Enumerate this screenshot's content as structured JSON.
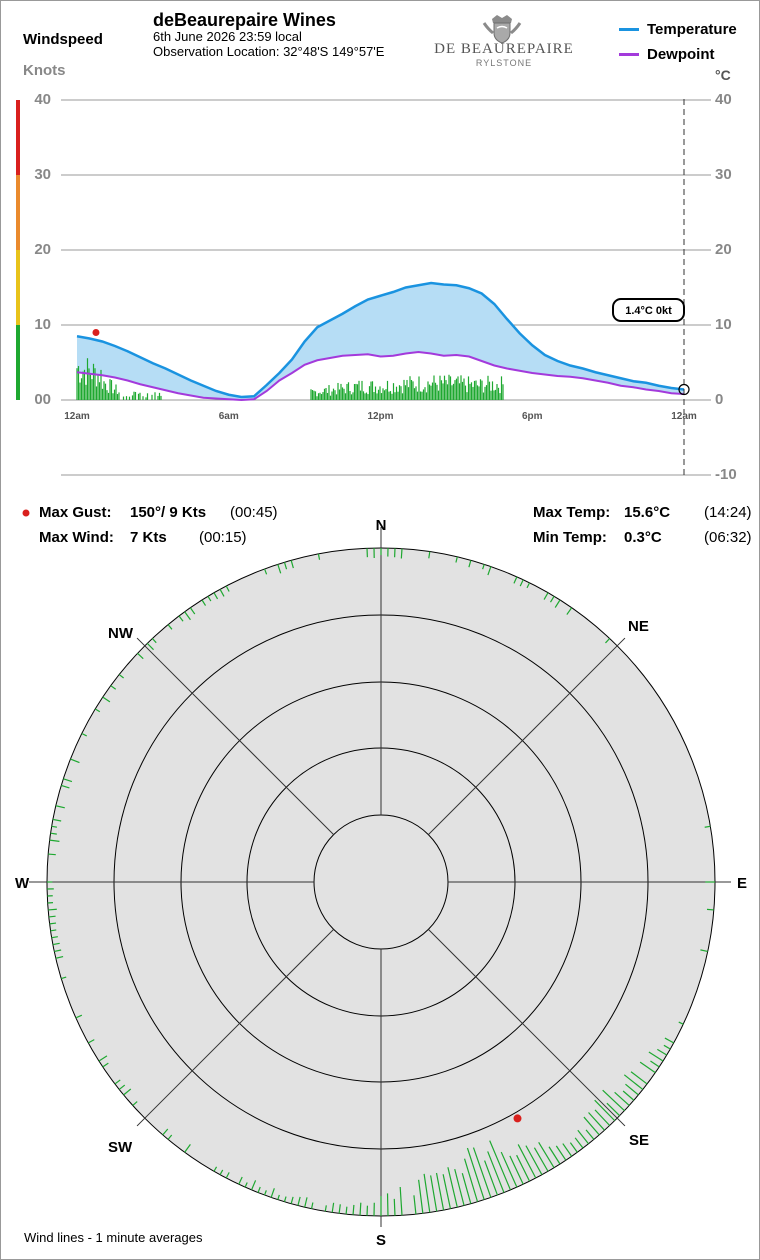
{
  "header": {
    "windspeed_label": "Windspeed",
    "knots_label": "Knots",
    "title": "deBeaurepaire Wines",
    "date_line": "6th June 2026  23:59 local",
    "location_line": "Observation Location: 32°48'S 149°57'E",
    "logo_line1": "DE BEAUREPAIRE",
    "logo_line2": "RYLSTONE",
    "celsius_label": "°C"
  },
  "legend": [
    {
      "name": "Temperature",
      "color": "#1a93e0"
    },
    {
      "name": "Dewpoint",
      "color": "#a33adb"
    }
  ],
  "colors": {
    "wind_bars": "#1ea830",
    "temp_fill": "#b6ddf5",
    "gust_marker": "#d9201d",
    "scale_green": "#1ea830",
    "scale_yellow": "#e8c31a",
    "scale_orange": "#ea8a2d",
    "scale_red": "#d9201d",
    "rose_bg": "#e2e2e2"
  },
  "current_label": "1.4°C  0kt",
  "stats": {
    "max_gust_label": "Max Gust:",
    "max_gust_value": "150°/  9 Kts",
    "max_gust_time": "(00:45)",
    "max_wind_label": "Max Wind:",
    "max_wind_value": "7 Kts",
    "max_wind_time": "(00:15)",
    "max_temp_label": "Max Temp:",
    "max_temp_value": "15.6°C",
    "max_temp_time": "(14:24)",
    "min_temp_label": "Min Temp:",
    "min_temp_value": "0.3°C",
    "min_temp_time": "(06:32)"
  },
  "compass": {
    "N": "N",
    "NE": "NE",
    "E": "E",
    "SE": "SE",
    "S": "S",
    "SW": "SW",
    "W": "W",
    "NW": "NW"
  },
  "footer": "Wind lines - 1 minute averages",
  "chart_data": [
    {
      "type": "line",
      "x_unit": "hours since midnight",
      "x_range": [
        0,
        24
      ],
      "x_ticks": [
        "12am",
        "6am",
        "12pm",
        "6pm",
        "12am"
      ],
      "y_left_ticks": [
        "40",
        "30",
        "20",
        "10",
        "00"
      ],
      "y_right_ticks": [
        "40",
        "30",
        "20",
        "10",
        "0",
        "-10"
      ],
      "ylim_left": [
        0,
        40
      ],
      "ylim_right": [
        -10,
        40
      ],
      "grid": true,
      "series": [
        {
          "name": "Temperature",
          "x": [
            0,
            0.5,
            1,
            1.5,
            2,
            2.5,
            3,
            3.5,
            4,
            4.5,
            5,
            5.5,
            6,
            6.5,
            7,
            7.5,
            8,
            8.5,
            9,
            9.5,
            10,
            10.5,
            11,
            11.5,
            12,
            12.5,
            13,
            13.5,
            14,
            14.5,
            15,
            15.5,
            16,
            16.5,
            17,
            17.5,
            18,
            18.5,
            19,
            19.5,
            20,
            20.5,
            21,
            21.5,
            22,
            22.5,
            23,
            23.5,
            24
          ],
          "values": [
            8.5,
            8.2,
            7.8,
            7.2,
            6.5,
            5.7,
            4.9,
            4.2,
            3.4,
            2.6,
            1.9,
            1.2,
            0.7,
            0.4,
            0.5,
            2.0,
            3.6,
            5.4,
            7.8,
            9.7,
            10.6,
            11.5,
            12.5,
            13.4,
            13.9,
            14.4,
            15.0,
            15.3,
            15.6,
            15.4,
            15.3,
            14.9,
            14.2,
            12.8,
            10.8,
            8.9,
            7.3,
            6.0,
            5.2,
            4.6,
            4.2,
            3.7,
            3.3,
            2.9,
            2.5,
            2.3,
            1.9,
            1.6,
            1.4
          ]
        },
        {
          "name": "Dewpoint",
          "x": [
            0,
            0.5,
            1,
            1.5,
            2,
            2.5,
            3,
            3.5,
            4,
            4.5,
            5,
            5.5,
            6,
            6.5,
            7,
            7.5,
            8,
            8.5,
            9,
            9.5,
            10,
            10.5,
            11,
            11.5,
            12,
            12.5,
            13,
            13.5,
            14,
            14.5,
            15,
            15.5,
            16,
            16.5,
            17,
            17.5,
            18,
            18.5,
            19,
            19.5,
            20,
            20.5,
            21,
            21.5,
            22,
            22.5,
            23,
            23.5,
            24
          ],
          "values": [
            3.7,
            3.5,
            3.3,
            3.0,
            2.6,
            2.1,
            1.7,
            1.3,
            0.9,
            0.6,
            0.3,
            0.2,
            0.1,
            0.0,
            0.1,
            1.2,
            2.6,
            3.6,
            4.7,
            5.3,
            5.6,
            5.9,
            6.0,
            6.1,
            5.8,
            5.9,
            6.2,
            6.4,
            6.2,
            5.9,
            6.0,
            5.8,
            5.2,
            4.6,
            4.2,
            3.9,
            3.6,
            3.4,
            3.2,
            3.1,
            2.9,
            2.6,
            2.3,
            1.9,
            1.7,
            1.4,
            1.2,
            0.9,
            0.8
          ]
        }
      ],
      "current": {
        "x": 24,
        "temperature": 1.4,
        "wind": 0
      },
      "max_gust": {
        "x": 0.75,
        "value": 9
      }
    },
    {
      "type": "polar",
      "directions": [
        "N",
        "NE",
        "E",
        "SE",
        "S",
        "SW",
        "W",
        "NW"
      ],
      "max_gust_direction_deg": 150,
      "max_gust_speed_kts": 9
    }
  ]
}
